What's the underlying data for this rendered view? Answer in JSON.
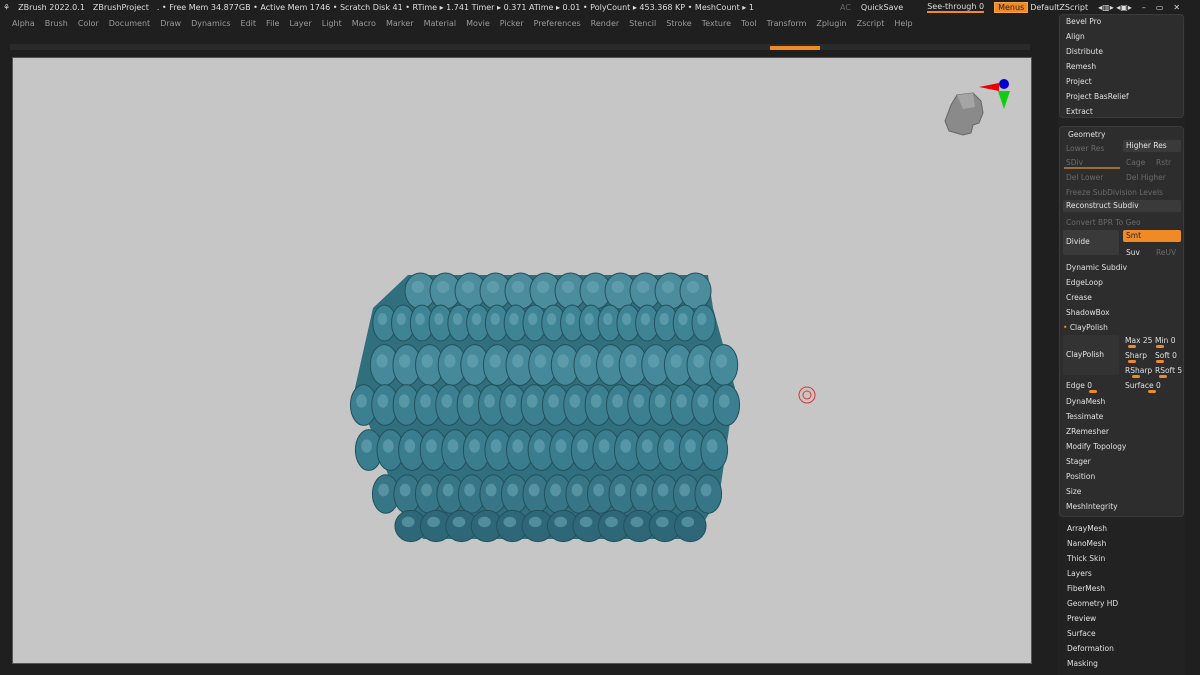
{
  "topbar": {
    "app": "ZBrush 2022.0.1",
    "project": "ZBrushProject",
    "stats": ". • Free Mem 34.877GB • Active Mem 1746 • Scratch Disk 41 •  RTime ▸ 1.741 Timer ▸ 0.371 ATime ▸ 0.01 • PolyCount ▸ 453.368 KP • MeshCount ▸ 1",
    "ac": "AC",
    "quicksave": "QuickSave",
    "seethrough": "See-through  0",
    "seethrough_value": 0,
    "menus": "Menus",
    "script": "DefaultZScript"
  },
  "menu": [
    "Alpha",
    "Brush",
    "Color",
    "Document",
    "Draw",
    "Dynamics",
    "Edit",
    "File",
    "Layer",
    "Light",
    "Macro",
    "Marker",
    "Material",
    "Movie",
    "Picker",
    "Preferences",
    "Render",
    "Stencil",
    "Stroke",
    "Texture",
    "Tool",
    "Transform",
    "Zplugin",
    "Zscript",
    "Help"
  ],
  "panel": {
    "top_items": [
      "Bevel Pro",
      "Align",
      "Distribute",
      "Remesh",
      "Project",
      "Project BasRelief",
      "Extract"
    ],
    "geometry": {
      "title": "Geometry",
      "lower_res": "Lower Res",
      "higher_res": "Higher Res",
      "sdiv": "SDiv",
      "cage": "Cage",
      "rstr": "Rstr",
      "del_lower": "Del Lower",
      "del_higher": "Del Higher",
      "freeze": "Freeze SubDivision Levels",
      "reconstruct": "Reconstruct Subdiv",
      "convert": "Convert BPR To Geo",
      "divide": "Divide",
      "smt": "Smt",
      "suv": "Suv",
      "reuv": "ReUV"
    },
    "mid_items": [
      "Dynamic Subdiv",
      "EdgeLoop",
      "Crease",
      "ShadowBox"
    ],
    "claypolish": {
      "title": "ClayPolish",
      "button": "ClayPolish",
      "max": "Max 25",
      "min": "Min 0",
      "sharp": "Sharp",
      "soft": "Soft 0",
      "rsharp": "RSharp",
      "rsoft": "RSoft 5",
      "edge": "Edge 0",
      "surface": "Surface 0"
    },
    "bottom_items": [
      "DynaMesh",
      "Tessimate",
      "ZRemesher",
      "Modify Topology",
      "Stager",
      "Position",
      "Size",
      "MeshIntegrity"
    ],
    "subpalettes": [
      "ArrayMesh",
      "NanoMesh",
      "Thick Skin",
      "Layers",
      "FiberMesh",
      "Geometry HD",
      "Preview",
      "Surface",
      "Deformation",
      "Masking"
    ]
  },
  "colors": {
    "accent": "#f08a24",
    "model": "#3f8494",
    "canvas": "#c6c6c6"
  }
}
